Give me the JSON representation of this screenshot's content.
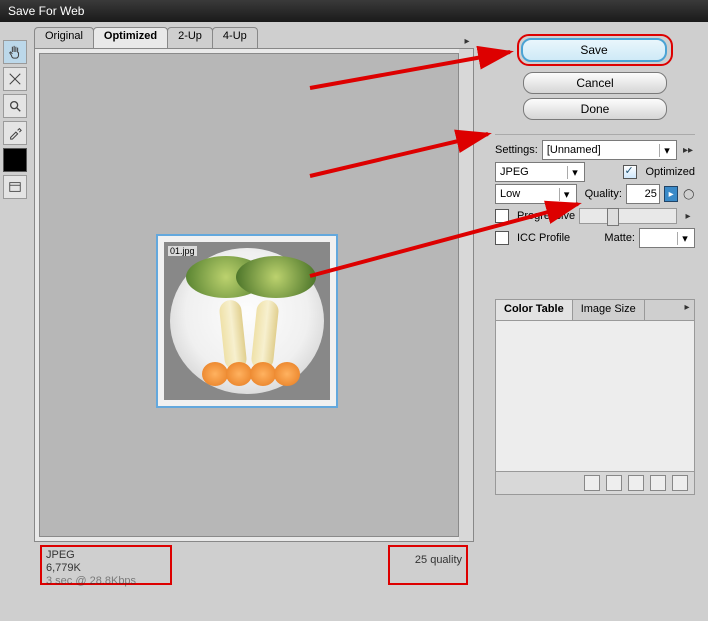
{
  "title": "Save For Web",
  "viewer": {
    "tabs": [
      "Original",
      "Optimized",
      "2-Up",
      "4-Up"
    ],
    "active_tab": 1,
    "thumb_tag": "01.jpg"
  },
  "footer": {
    "format": "JPEG",
    "size": "6,779K",
    "timing": "3 sec @ 28.8Kbps",
    "quality_label": "25 quality"
  },
  "buttons": {
    "save": "Save",
    "cancel": "Cancel",
    "done": "Done"
  },
  "settings": {
    "label": "Settings:",
    "preset": "[Unnamed]",
    "format": "JPEG",
    "optimized_label": "Optimized",
    "optimized": true,
    "quality_preset": "Low",
    "quality_label": "Quality:",
    "quality": "25",
    "progressive_label": "Progressive",
    "progressive": false,
    "icc_label": "ICC Profile",
    "icc": false,
    "matte_label": "Matte:"
  },
  "colortable": {
    "tabs": [
      "Color Table",
      "Image Size"
    ],
    "active": 0
  },
  "tools": [
    "hand",
    "slice",
    "zoom",
    "eyedropper"
  ]
}
